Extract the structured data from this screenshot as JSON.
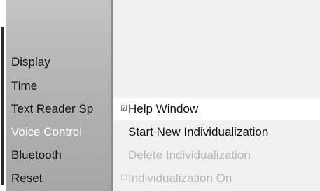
{
  "left_menu": {
    "items": [
      {
        "label": "Display",
        "active": false
      },
      {
        "label": "Time",
        "active": false
      },
      {
        "label": "Text Reader Sp",
        "active": false
      },
      {
        "label": "Voice Control",
        "active": true
      },
      {
        "label": "Bluetooth",
        "active": false
      },
      {
        "label": "Reset",
        "active": false
      }
    ]
  },
  "submenu": {
    "items": [
      {
        "label": "Help Window",
        "check": "☑",
        "enabled": true,
        "highlighted": true
      },
      {
        "label": "Start New Individualization",
        "check": "",
        "enabled": true,
        "highlighted": false
      },
      {
        "label": "Delete Individualization",
        "check": "",
        "enabled": false,
        "highlighted": false
      },
      {
        "label": "Individualization On",
        "check": "☐",
        "enabled": false,
        "highlighted": false
      }
    ]
  },
  "colors": {
    "active_text": "#ffffff",
    "enabled_text": "#111111",
    "disabled_text": "#b7b7b7"
  }
}
